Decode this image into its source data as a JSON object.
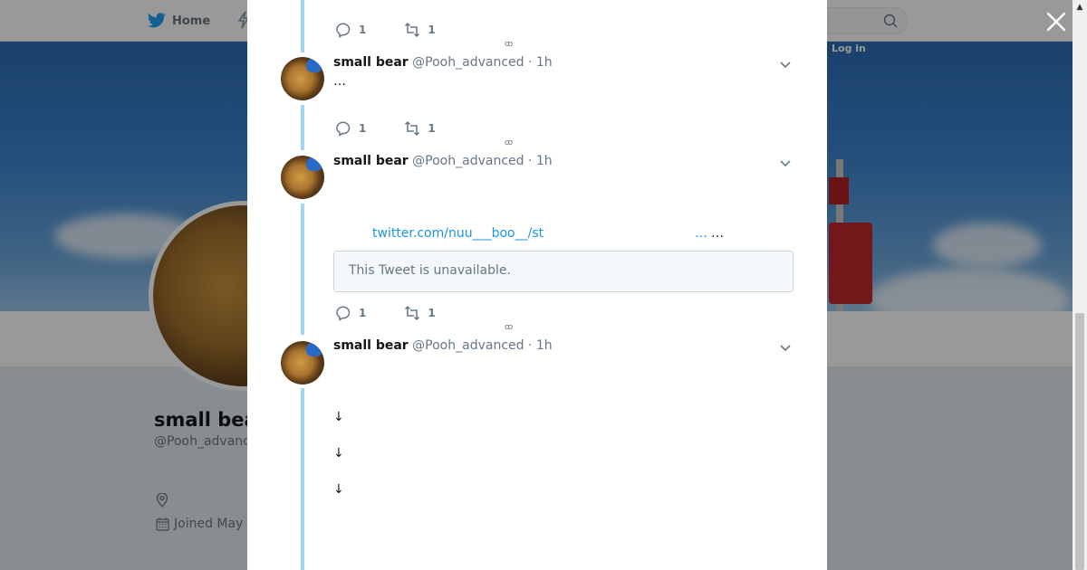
{
  "nav": {
    "home_label": "Home",
    "login_label": "Log in"
  },
  "profile": {
    "name": "small bear",
    "handle": "@Pooh_advanced",
    "joined": "Joined May"
  },
  "scrollbar": {
    "up_arrow": "▲"
  },
  "colors": {
    "link": "#1b95e0",
    "thread_line": "#a6d4f2",
    "text_secondary": "#657786",
    "overlay": "rgba(0,0,0,0.4)"
  },
  "tweets": [
    {
      "replies": "1",
      "retweets": "1",
      "more": "ꝏ"
    },
    {
      "name": "small bear",
      "handle": "@Pooh_advanced",
      "dot": "·",
      "time": "1h",
      "text": "…",
      "replies": "1",
      "retweets": "1",
      "more": "ꝏ"
    },
    {
      "name": "small bear",
      "handle": "@Pooh_advanced",
      "dot": "·",
      "time": "1h",
      "link": "twitter.com/nuu___boo__/st",
      "link_ellipsis": "…",
      "ellipsis": "…",
      "quoted": "This Tweet is unavailable.",
      "replies": "1",
      "retweets": "1",
      "more": "ꝏ"
    },
    {
      "name": "small bear",
      "handle": "@Pooh_advanced",
      "dot": "·",
      "time": "1h",
      "lines": [
        "↓",
        "↓",
        "↓"
      ]
    }
  ]
}
